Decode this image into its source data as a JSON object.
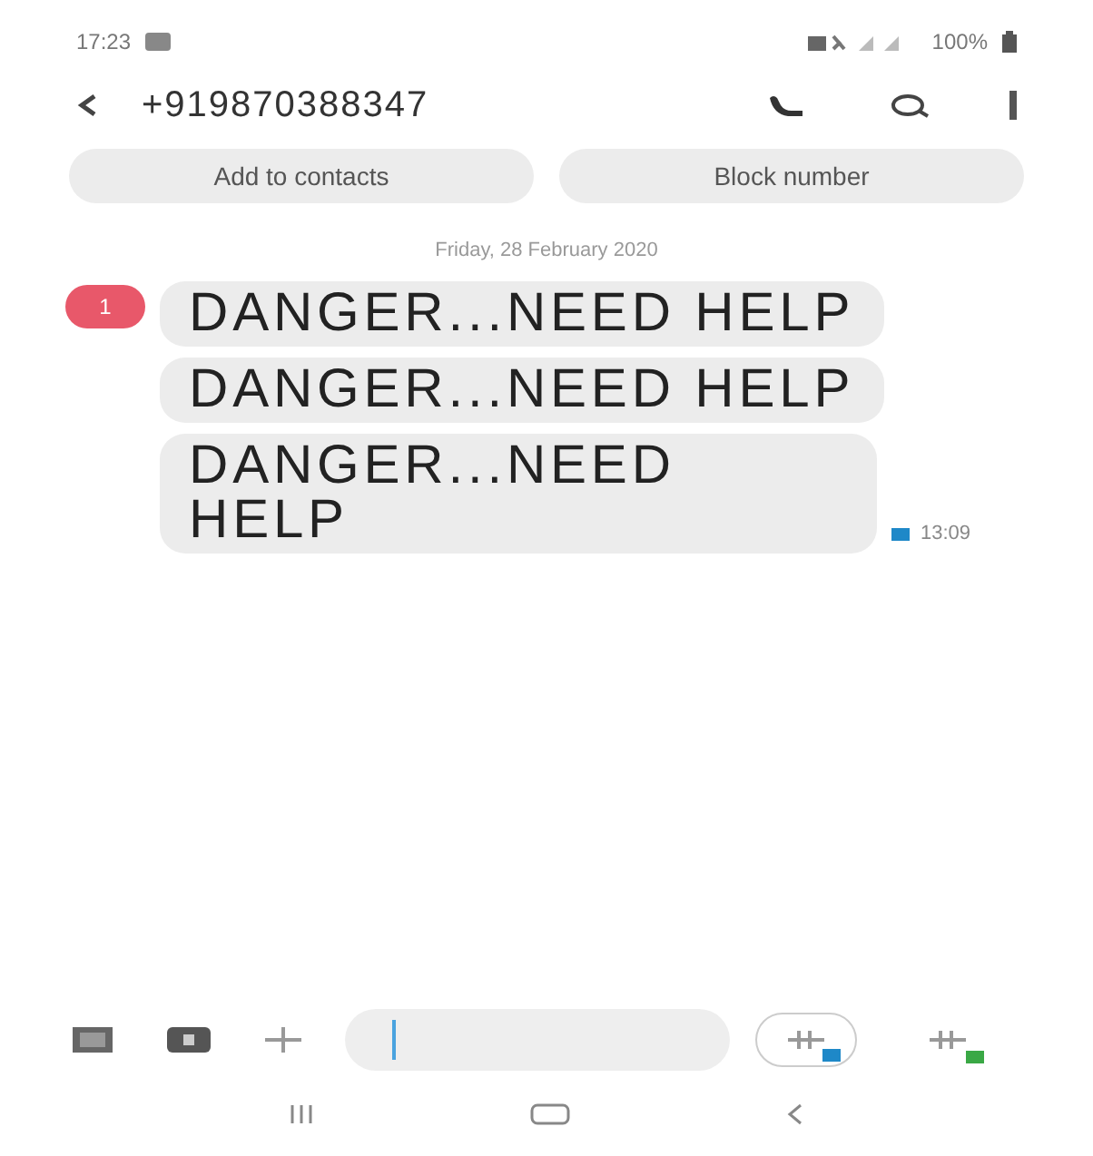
{
  "status_bar": {
    "time": "17:23",
    "battery": "100%"
  },
  "header": {
    "title": "+919870388347"
  },
  "actions": [
    "Add to contacts",
    "Block number"
  ],
  "date_divider": "Friday, 28 February 2020",
  "unread_badge": "1",
  "messages": [
    {
      "text": "DANGER...NEED HELP"
    },
    {
      "text": "DANGER...NEED HELP"
    },
    {
      "text": "DANGER...NEED HELP",
      "time": "13:09"
    }
  ],
  "composer": {
    "send_buttons": [
      {
        "selected": true,
        "color": "#1e88c8"
      },
      {
        "selected": false,
        "color": "#3aa845"
      }
    ]
  }
}
